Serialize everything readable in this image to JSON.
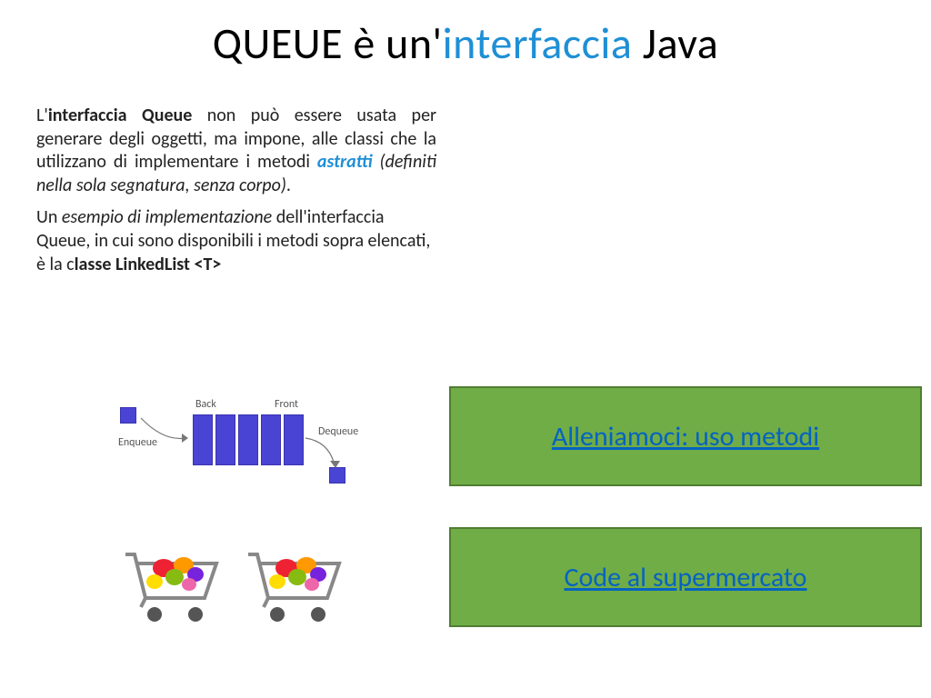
{
  "title": {
    "pre": "QUEUE è un'",
    "hl": "interfaccia",
    "post": " Java"
  },
  "paragraph1": {
    "t1": "L'",
    "t2": "interfaccia Queue",
    "t3": " non può essere usata per generare degli oggetti, ma impone, alle classi che la utilizzano di implementare i metodi ",
    "t4": "astratti",
    "t5": " (definiti nella sola segnatura, senza corpo)",
    "t6": "."
  },
  "paragraph2": {
    "t1": "Un ",
    "t2": "esempio di implementazione ",
    "t3": "dell'interfaccia Queue, in cui sono disponibili  i metodi sopra elencati, è la c",
    "t4": "lasse LinkedList <T>"
  },
  "diagram": {
    "back": "Back",
    "front": "Front",
    "enqueue": "Enqueue",
    "dequeue": "Dequeue"
  },
  "links": {
    "link1": "Alleniamoci: uso metodi",
    "link2": "Code al supermercato"
  }
}
